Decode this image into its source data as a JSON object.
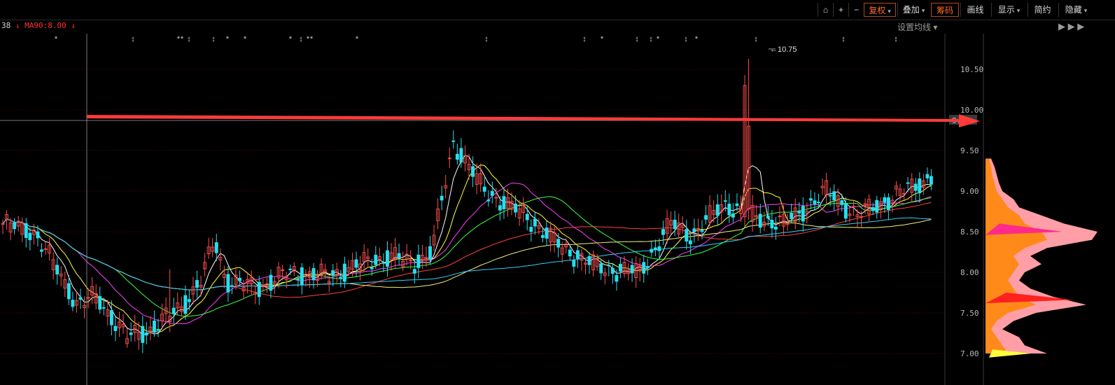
{
  "toolbar": {
    "buttons": [
      {
        "label": "⌂",
        "icon": "lock-icon"
      },
      {
        "label": "+",
        "icon": "zoom-in-icon"
      },
      {
        "label": "−",
        "icon": "zoom-out-icon"
      },
      {
        "label": "复权",
        "active": true,
        "caret": true
      },
      {
        "label": "叠加",
        "caret": true
      },
      {
        "label": "筹码",
        "active": true
      },
      {
        "label": "画线"
      },
      {
        "label": "显示",
        "caret": true
      },
      {
        "label": "简约"
      },
      {
        "label": "隐藏",
        "caret": true
      }
    ]
  },
  "legend": {
    "prefix": "38",
    "arrow1": "↓",
    "ma_label": "MA90:8.00",
    "arrow2": "↓"
  },
  "ma_setting": "设置均线",
  "ma_setting_caret": "▾",
  "panel_icons": "▶ ▶ ▶",
  "high_label": "←10.75",
  "crosshair_label": "9.87",
  "colors": {
    "up": "#ff4d4d",
    "down": "#22e0f0",
    "ma5": "#ffffff",
    "ma10": "#ffff40",
    "ma20": "#ff40ff",
    "ma30": "#40ff40",
    "ma60": "#ff4040",
    "ma90": "#f5f07a",
    "ma120": "#30d0ff",
    "arrow": "#ff3b3b",
    "grid": "#7a1010"
  },
  "chart_data": {
    "type": "candlestick",
    "title": "",
    "ylim": [
      6.85,
      10.95
    ],
    "y_ticks": [
      "10.50",
      "10.00",
      "9.50",
      "9.00",
      "8.50",
      "8.00",
      "7.50",
      "7.00"
    ],
    "y_tick_values": [
      10.5,
      10.0,
      9.5,
      9.0,
      8.5,
      8.0,
      7.5,
      7.0
    ],
    "high_value": 10.75,
    "resistance_level": 9.87,
    "event_marker_positions": [
      80,
      190,
      255,
      260,
      270,
      305,
      325,
      350,
      415,
      430,
      440,
      445,
      510,
      695,
      835,
      860,
      910,
      930,
      940,
      980,
      995,
      1080,
      1205,
      1280
    ],
    "event_marker_glyphs": [
      "*",
      "↕",
      "*",
      "*",
      "↕",
      "↕",
      "*",
      "*",
      "*",
      "↕",
      "*",
      "*",
      "*",
      "↕",
      "↕",
      "*",
      "↕",
      "↕",
      "*",
      "↕",
      "*",
      "↕",
      "↕",
      "↕"
    ],
    "chip_distribution": {
      "prices": [
        7.0,
        7.1,
        7.2,
        7.3,
        7.4,
        7.5,
        7.6,
        7.7,
        7.8,
        7.9,
        8.0,
        8.1,
        8.2,
        8.3,
        8.4,
        8.5,
        8.6,
        8.7,
        8.8,
        8.9,
        9.0,
        9.1,
        9.2,
        9.3,
        9.4
      ],
      "profit_volume": [
        0.55,
        0.35,
        0.3,
        0.15,
        0.25,
        0.45,
        0.9,
        0.6,
        0.4,
        0.3,
        0.35,
        0.5,
        0.4,
        0.55,
        0.95,
        1.0,
        0.7,
        0.5,
        0.3,
        0.25,
        0.15,
        0.12,
        0.1,
        0.08,
        0.05
      ],
      "locked_volume": [
        0.2,
        0.15,
        0.1,
        0.05,
        0.1,
        0.2,
        0.45,
        0.3,
        0.25,
        0.2,
        0.25,
        0.3,
        0.25,
        0.35,
        0.55,
        0.5,
        0.35,
        0.3,
        0.2,
        0.15,
        0.1,
        0.08,
        0.06,
        0.05,
        0.03
      ]
    }
  }
}
